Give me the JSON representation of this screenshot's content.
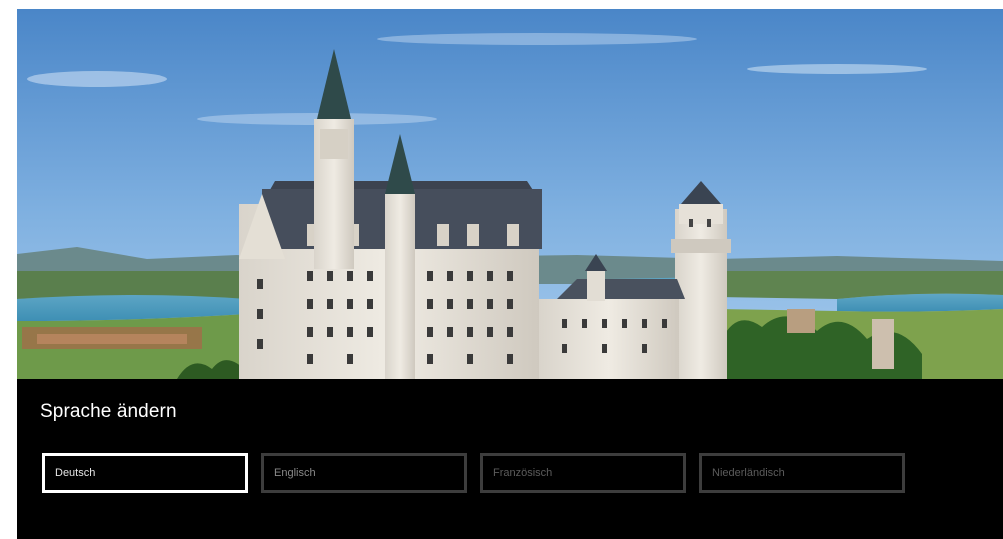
{
  "screen": {
    "background_image": "neuschwanstein-castle-landscape",
    "accent_color": "#ffffff",
    "panel_color": "#000000"
  },
  "language_panel": {
    "title": "Sprache ändern",
    "options": [
      {
        "label": "Deutsch",
        "selected": true
      },
      {
        "label": "Englisch",
        "selected": false
      },
      {
        "label": "Französisch",
        "selected": false
      },
      {
        "label": "Niederländisch",
        "selected": false
      }
    ]
  }
}
